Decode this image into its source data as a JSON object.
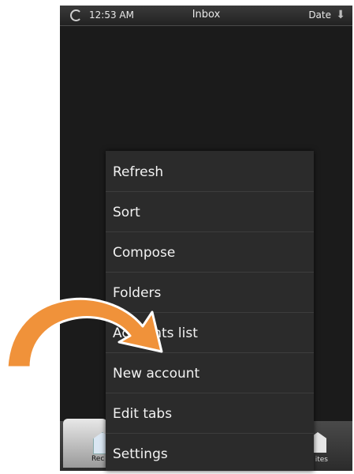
{
  "status_bar": {
    "time": "12:53 AM",
    "title": "Inbox",
    "sort_label": "Date",
    "icons": {
      "sync": "sync-icon",
      "sort": "arrow-down-icon"
    }
  },
  "bottom_tabs": {
    "left_label": "Rec",
    "right_label": "ites"
  },
  "menu": {
    "items": [
      "Refresh",
      "Sort",
      "Compose",
      "Folders",
      "Accounts list",
      "New account",
      "Edit tabs",
      "Settings"
    ]
  },
  "colors": {
    "screen_bg": "#1b1b1b",
    "menu_bg": "#2b2b2b",
    "arrow": "#f0923a"
  }
}
